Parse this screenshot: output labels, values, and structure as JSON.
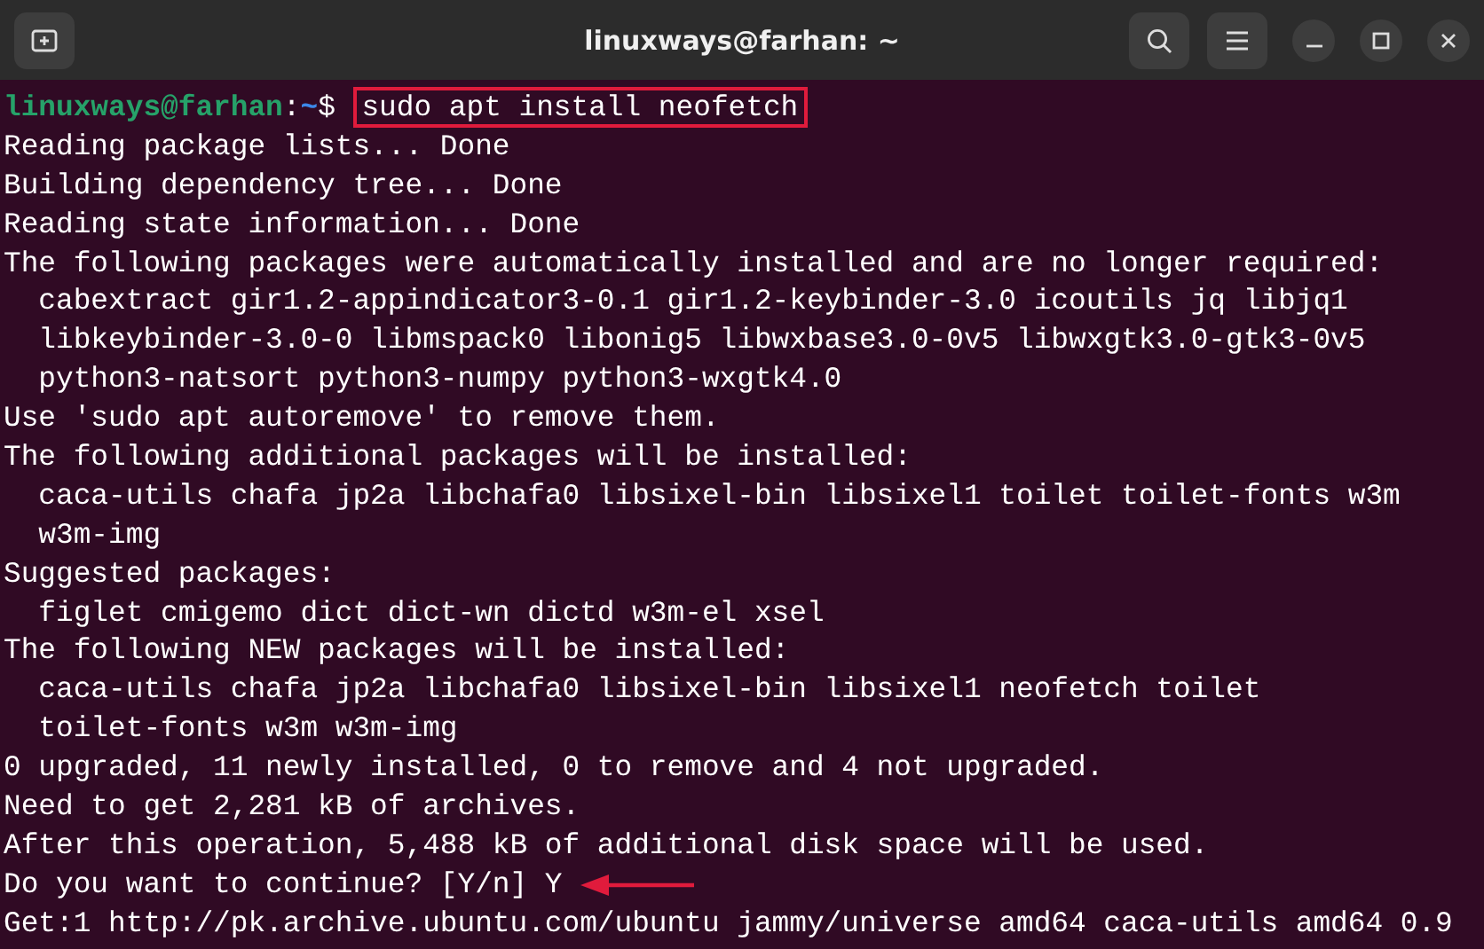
{
  "window": {
    "title": "linuxways@farhan: ~"
  },
  "prompt": {
    "user_host": "linuxways@farhan",
    "separator": ":",
    "path": "~",
    "symbol": "$",
    "command": "sudo apt install neofetch",
    "highlighted": true
  },
  "lines": [
    {
      "kind": "output",
      "text": "Reading package lists... Done"
    },
    {
      "kind": "output",
      "text": "Building dependency tree... Done"
    },
    {
      "kind": "output",
      "text": "Reading state information... Done"
    },
    {
      "kind": "output",
      "text": "The following packages were automatically installed and are no longer required:"
    },
    {
      "kind": "output",
      "text": "  cabextract gir1.2-appindicator3-0.1 gir1.2-keybinder-3.0 icoutils jq libjq1"
    },
    {
      "kind": "output",
      "text": "  libkeybinder-3.0-0 libmspack0 libonig5 libwxbase3.0-0v5 libwxgtk3.0-gtk3-0v5"
    },
    {
      "kind": "output",
      "text": "  python3-natsort python3-numpy python3-wxgtk4.0"
    },
    {
      "kind": "output",
      "text": "Use 'sudo apt autoremove' to remove them."
    },
    {
      "kind": "output",
      "text": "The following additional packages will be installed:"
    },
    {
      "kind": "output",
      "text": "  caca-utils chafa jp2a libchafa0 libsixel-bin libsixel1 toilet toilet-fonts w3m"
    },
    {
      "kind": "output",
      "text": "  w3m-img"
    },
    {
      "kind": "output",
      "text": "Suggested packages:"
    },
    {
      "kind": "output",
      "text": "  figlet cmigemo dict dict-wn dictd w3m-el xsel"
    },
    {
      "kind": "output",
      "text": "The following NEW packages will be installed:"
    },
    {
      "kind": "output",
      "text": "  caca-utils chafa jp2a libchafa0 libsixel-bin libsixel1 neofetch toilet"
    },
    {
      "kind": "output",
      "text": "  toilet-fonts w3m w3m-img"
    },
    {
      "kind": "output",
      "text": "0 upgraded, 11 newly installed, 0 to remove and 4 not upgraded."
    },
    {
      "kind": "output",
      "text": "Need to get 2,281 kB of archives."
    },
    {
      "kind": "output",
      "text": "After this operation, 5,488 kB of additional disk space will be used."
    },
    {
      "kind": "question",
      "text": "Do you want to continue? [Y/n]",
      "answer": "Y",
      "marked": true
    },
    {
      "kind": "output",
      "text": "Get:1 http://pk.archive.ubuntu.com/ubuntu jammy/universe amd64 caca-utils amd64 0.9"
    }
  ]
}
